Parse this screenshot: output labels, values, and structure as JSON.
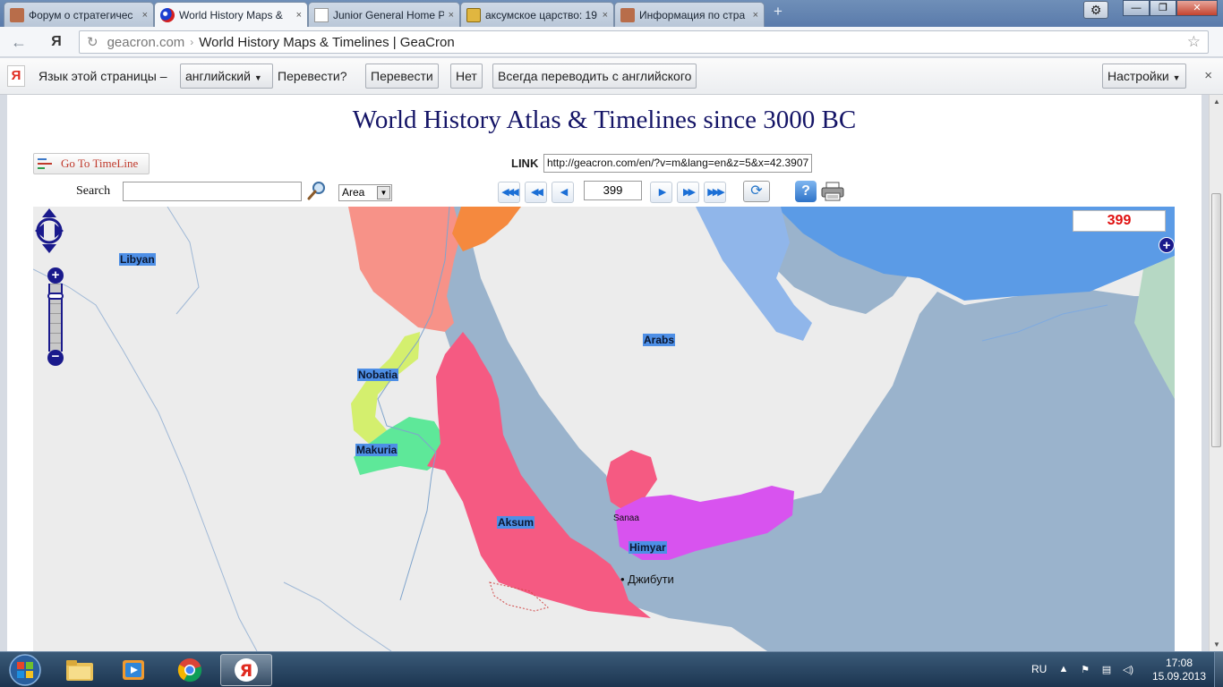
{
  "browser": {
    "tabs": [
      {
        "title": "Форум о стратегичес",
        "favicon_color": "#b86d4a",
        "active": false
      },
      {
        "title": "World History Maps &",
        "favicon_color": "#d42020",
        "active": true
      },
      {
        "title": "Junior General Home P",
        "favicon_color": "#ffffff",
        "active": false
      },
      {
        "title": "аксумское царство: 19",
        "favicon_color": "#e0b640",
        "active": false
      },
      {
        "title": "Информация по стра",
        "favicon_color": "#b86d4a",
        "active": false
      }
    ],
    "tab_close_glyph": "×",
    "new_tab_glyph": "+",
    "window_buttons": {
      "minimize": "—",
      "maximize": "❐",
      "close": "✕"
    },
    "settings_glyph": "⚙",
    "address": {
      "domain": "geacron.com",
      "separator": "›",
      "page_title": "World History Maps & Timelines | GeaCron"
    },
    "translate_bar": {
      "yandex_logo": "Я",
      "language_label": "Язык этой страницы –",
      "language_value": "английский",
      "question": "Перевести?",
      "translate_btn": "Перевести",
      "no_btn": "Нет",
      "always_btn": "Всегда переводить с английского",
      "settings_btn": "Настройки",
      "close_glyph": "×"
    }
  },
  "site": {
    "title": "World History Atlas & Timelines since 3000 BC",
    "goto_timeline": "Go To TimeLine",
    "link_label": "LINK",
    "link_value": "http://geacron.com/en/?v=m&lang=en&z=5&x=42.3907",
    "search_label": "Search",
    "search_value": "",
    "area_select": "Area",
    "year_value": "399",
    "nav": {
      "first": "◀◀◀",
      "prev_big": "◀◀",
      "prev": "◀",
      "next": "▶",
      "next_big": "▶▶",
      "last": "▶▶▶"
    },
    "refresh_glyph": "⟳",
    "help_glyph": "?"
  },
  "map": {
    "year_badge": "399",
    "plus_glyph": "+",
    "zoom_in": "+",
    "zoom_out": "−",
    "labels": {
      "libyan": "Libyan",
      "arabs": "Arabs",
      "nobatia": "Nobatia",
      "makuria": "Makuria",
      "aksum": "Aksum",
      "himyar": "Himyar"
    },
    "cities": {
      "sanaa": "Sanaa",
      "djibouti": "Джибути"
    },
    "colors": {
      "land": "#ececec",
      "sea": "#9ab3cc",
      "egypt": "#f79288",
      "orange": "#f5893e",
      "nobatia": "#d4ef6e",
      "makuria": "#5ee899",
      "aksum": "#f55a82",
      "himyar": "#d853ef",
      "persia": "#5b9be6",
      "persia_light": "#90b6ea",
      "label_bg": "#4e8fe6"
    }
  },
  "taskbar": {
    "lang": "RU",
    "time": "17:08",
    "date": "15.09.2013"
  }
}
